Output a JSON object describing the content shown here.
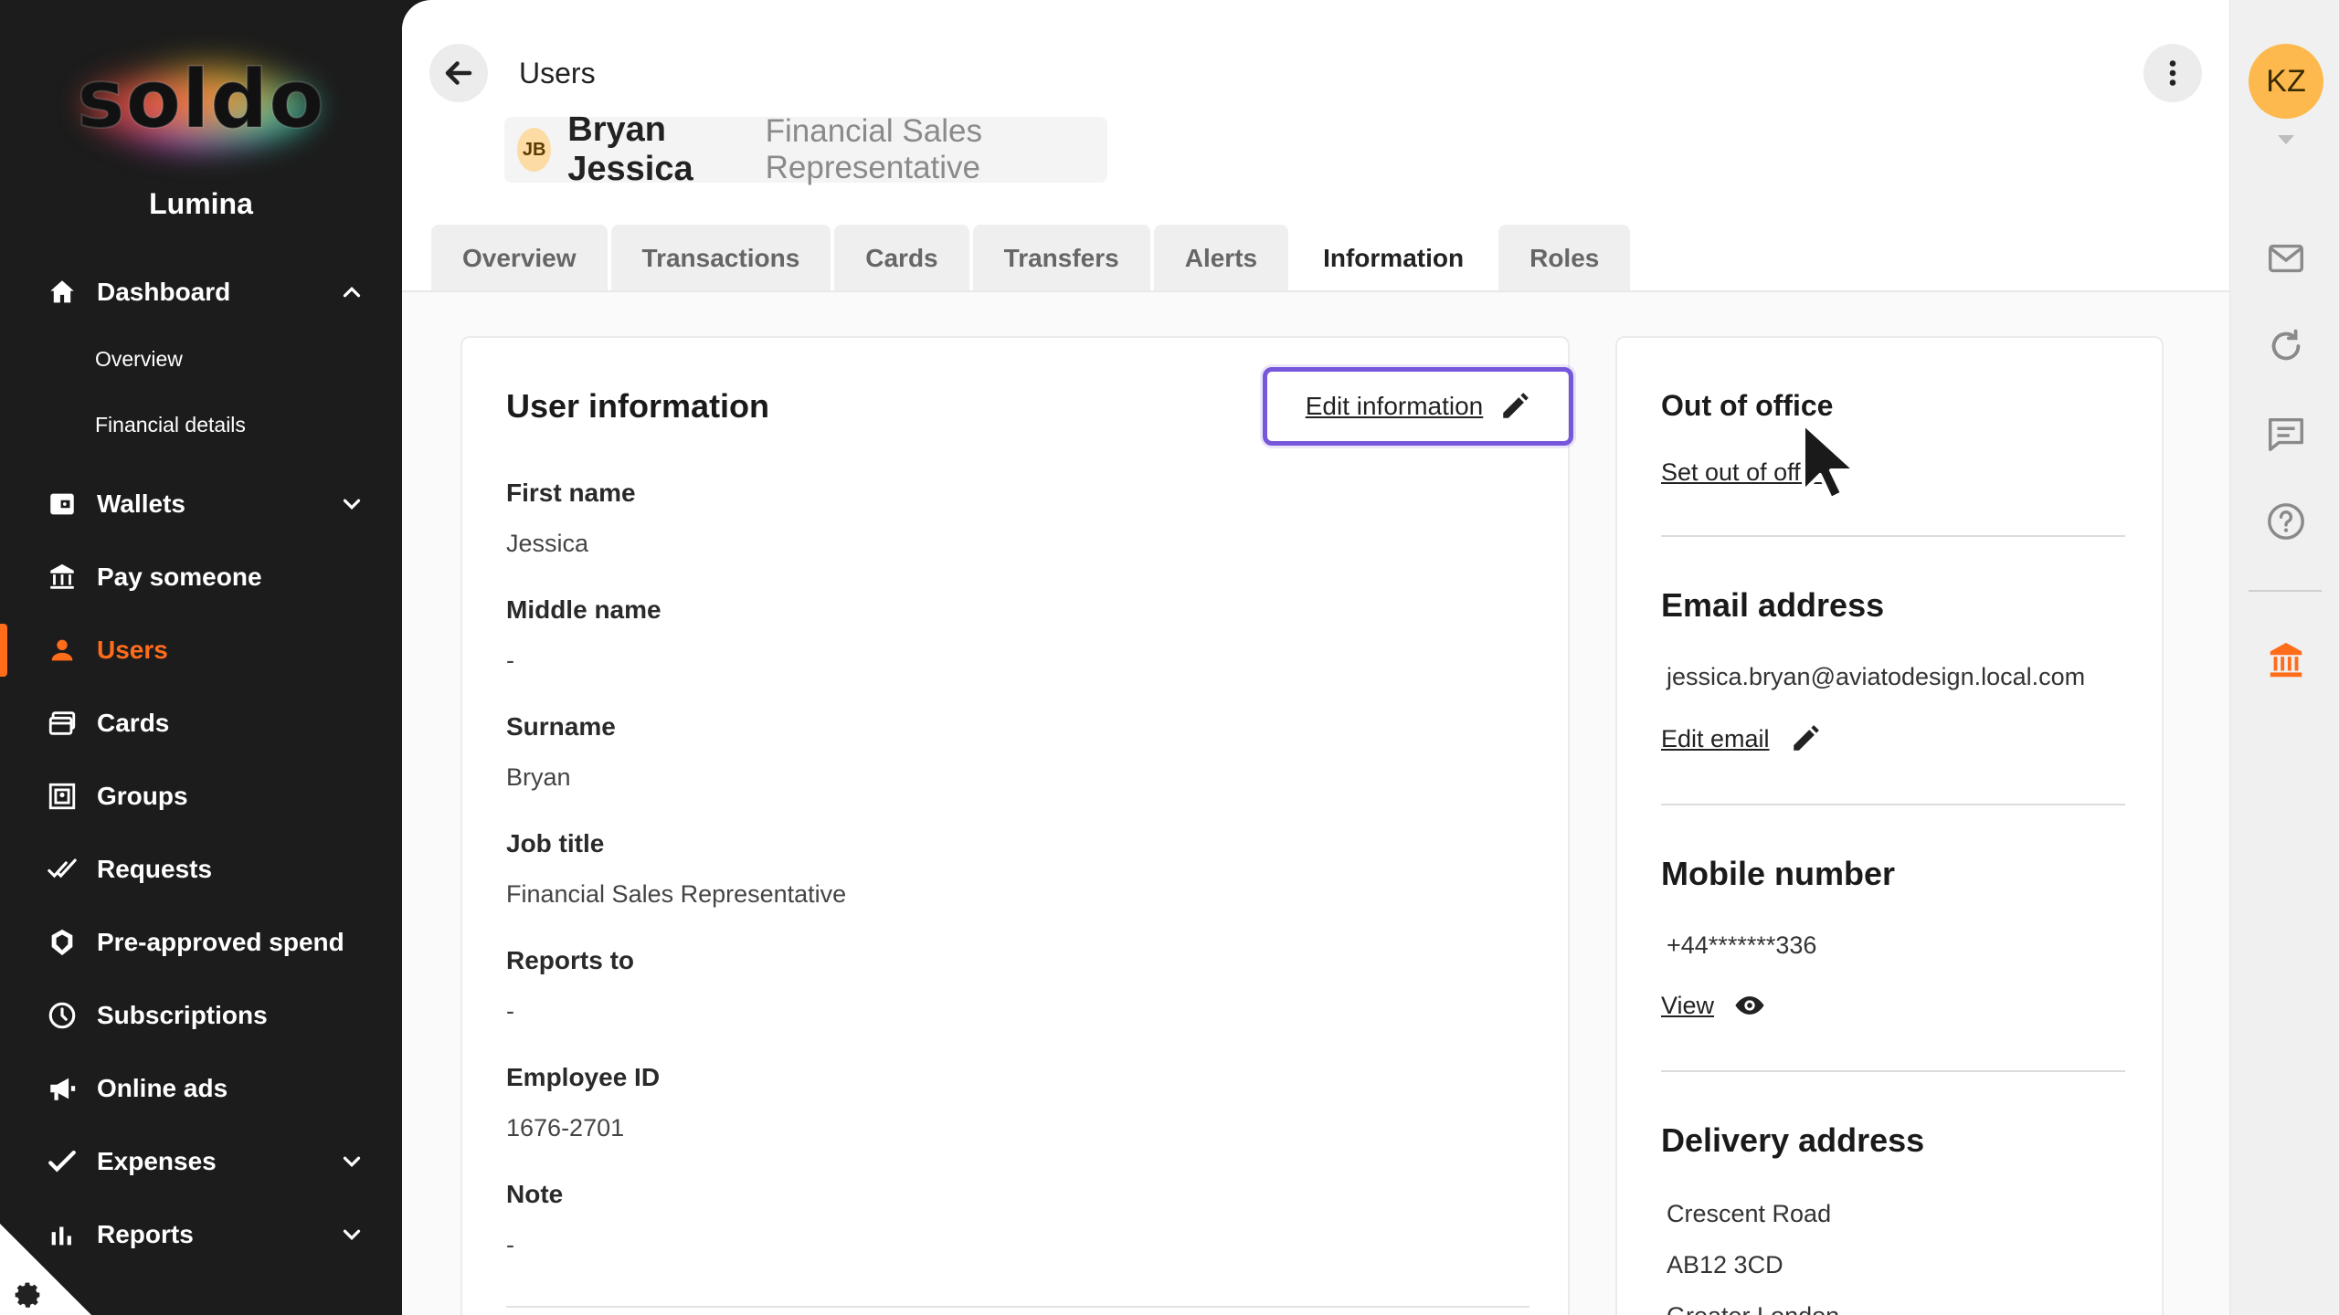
{
  "sidebar": {
    "logo_text": "soldo",
    "company": "Lumina",
    "dashboard": {
      "label": "Dashboard",
      "icon": "home-icon",
      "sub_items": [
        "Overview",
        "Financial details"
      ]
    },
    "items": [
      {
        "label": "Wallets",
        "icon": "wallet-icon"
      },
      {
        "label": "Pay someone",
        "icon": "bank-transfer-icon"
      },
      {
        "label": "Users",
        "icon": "user-icon",
        "active": true
      },
      {
        "label": "Cards",
        "icon": "cards-icon"
      },
      {
        "label": "Groups",
        "icon": "groups-icon"
      },
      {
        "label": "Requests",
        "icon": "requests-icon"
      },
      {
        "label": "Pre-approved spend",
        "icon": "shield-icon"
      },
      {
        "label": "Subscriptions",
        "icon": "clock-icon"
      },
      {
        "label": "Online ads",
        "icon": "megaphone-icon"
      },
      {
        "label": "Expenses",
        "icon": "check-icon"
      },
      {
        "label": "Reports",
        "icon": "chart-icon"
      }
    ]
  },
  "header": {
    "breadcrumb": "Users",
    "user_initials": "JB",
    "user_name": "Bryan Jessica",
    "user_role": "Financial Sales Representative"
  },
  "tabs": [
    "Overview",
    "Transactions",
    "Cards",
    "Transfers",
    "Alerts",
    "Information",
    "Roles"
  ],
  "active_tab": "Information",
  "user_info": {
    "title": "User information",
    "edit_label": "Edit information",
    "fields": [
      {
        "label": "First name",
        "value": "Jessica"
      },
      {
        "label": "Middle name",
        "value": "-"
      },
      {
        "label": "Surname",
        "value": "Bryan"
      },
      {
        "label": "Job title",
        "value": "Financial Sales Representative"
      },
      {
        "label": "Reports to",
        "value": "-"
      },
      {
        "label": "Employee ID",
        "value": "1676-2701"
      },
      {
        "label": "Note",
        "value": "-"
      }
    ]
  },
  "side": {
    "out_of_office_title": "Out of office",
    "set_out_of_office": "Set out of office",
    "email_title": "Email address",
    "email_value": "jessica.bryan@aviatodesign.local.com",
    "edit_email": "Edit email",
    "mobile_title": "Mobile number",
    "mobile_value": "+44*******336",
    "view_label": "View",
    "delivery_title": "Delivery address",
    "delivery_line1": "Crescent Road",
    "delivery_line2": "AB12 3CD",
    "delivery_line3": "Greater London"
  },
  "rail": {
    "avatar_initials": "KZ",
    "icons": [
      "mail-icon",
      "refresh-icon",
      "chat-icon",
      "help-icon",
      "bank-icon"
    ]
  },
  "colors": {
    "accent": "#ff6c1a",
    "focus": "#7657d9",
    "avatar": "#fdb94d"
  }
}
